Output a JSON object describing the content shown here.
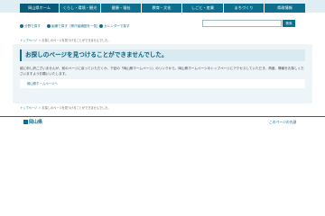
{
  "nav": {
    "items": [
      {
        "label": "岡山県ホーム"
      },
      {
        "label": "くらし・環境・観光"
      },
      {
        "label": "健康・福祉"
      },
      {
        "label": "教育・文化"
      },
      {
        "label": "しごと・産業"
      },
      {
        "label": "まちづくり"
      },
      {
        "label": "県政情報"
      }
    ]
  },
  "util": {
    "links": [
      {
        "label": "分野で探す"
      },
      {
        "label": "組織で探す（県庁組織図を一覧）"
      },
      {
        "label": "カレンダーで探す"
      }
    ],
    "search_placeholder": "",
    "search_button": "検索"
  },
  "breadcrumb": {
    "top": "トップページ",
    "separator": "＞",
    "current": "お探しのページを見つけることができませんでした。"
  },
  "main": {
    "heading": "お探しのページを見つけることができませんでした。",
    "description": "誠に申し訳ございませんが、前のページに戻っていただくか、下記の「岡山県ホームページ」のリンクから、岡山県ホームページのトップページにアクセスしていただき、再度、情報をお探しくださいますようお願いいたします。",
    "home_link": "岡山県ホームページへ"
  },
  "footer": {
    "logo_text": "岡山県",
    "page_top": "このページの先頭"
  },
  "colors": {
    "brand": "#0e6e8e",
    "topbar_bg": "#dfeef4",
    "main_bg": "#eef5f8"
  }
}
